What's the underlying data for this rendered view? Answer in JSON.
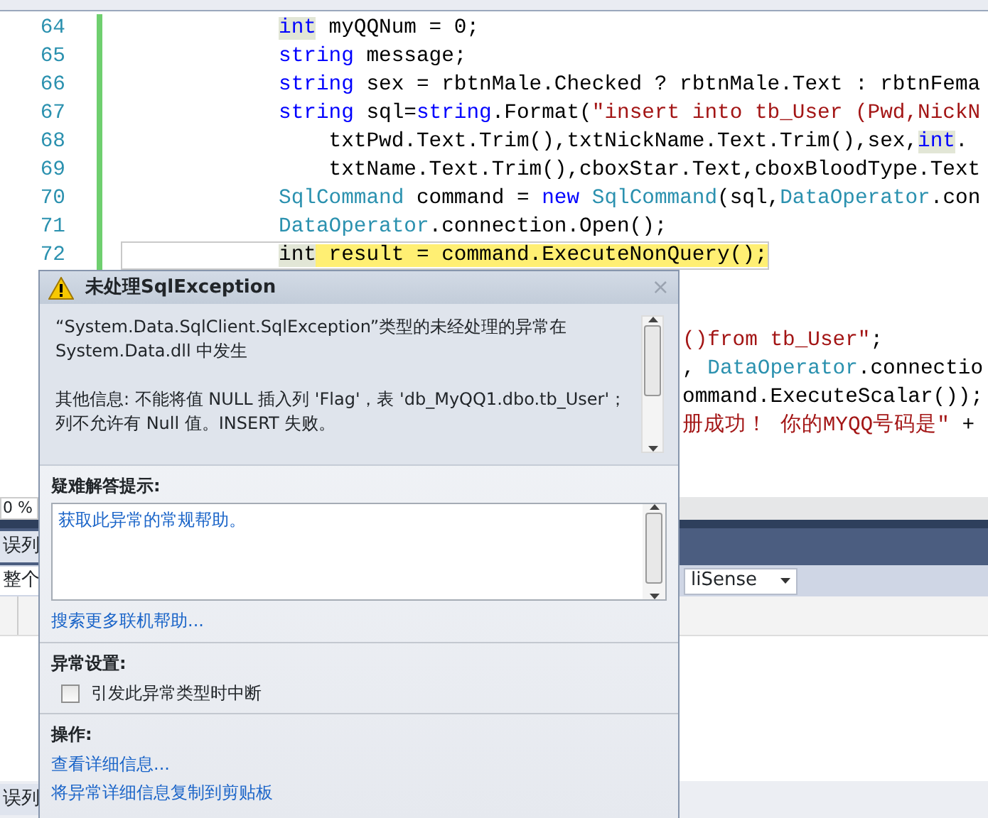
{
  "code": {
    "lines": [
      {
        "number": "64",
        "current": false,
        "tokens": [
          {
            "text": "int",
            "kind": "kw_ref"
          },
          {
            "text": " myQQNum = 0;",
            "kind": "plain"
          }
        ]
      },
      {
        "number": "65",
        "current": false,
        "tokens": [
          {
            "text": "string",
            "kind": "kw"
          },
          {
            "text": " message;",
            "kind": "plain"
          }
        ]
      },
      {
        "number": "66",
        "current": false,
        "tokens": [
          {
            "text": "string",
            "kind": "kw"
          },
          {
            "text": " sex = rbtnMale.Checked ? rbtnMale.Text : rbtnFema",
            "kind": "plain"
          }
        ]
      },
      {
        "number": "67",
        "current": false,
        "tokens": [
          {
            "text": "string",
            "kind": "kw"
          },
          {
            "text": " sql=",
            "kind": "plain"
          },
          {
            "text": "string",
            "kind": "kw"
          },
          {
            "text": ".Format(",
            "kind": "plain"
          },
          {
            "text": "\"insert into tb_User (Pwd,NickN",
            "kind": "str"
          }
        ]
      },
      {
        "number": "68",
        "current": false,
        "tokens": [
          {
            "text": "    txtPwd.Text.Trim(),txtNickName.Text.Trim(),sex,",
            "kind": "plain"
          },
          {
            "text": "int",
            "kind": "kw_ref"
          },
          {
            "text": ".",
            "kind": "plain"
          }
        ]
      },
      {
        "number": "69",
        "current": false,
        "tokens": [
          {
            "text": "    txtName.Text.Trim(),cboxStar.Text,cboxBloodType.Text",
            "kind": "plain"
          }
        ]
      },
      {
        "number": "70",
        "current": false,
        "tokens": [
          {
            "text": "SqlCommand",
            "kind": "type"
          },
          {
            "text": " command = ",
            "kind": "plain"
          },
          {
            "text": "new ",
            "kind": "kw"
          },
          {
            "text": "SqlCommand",
            "kind": "type"
          },
          {
            "text": "(sql,",
            "kind": "plain"
          },
          {
            "text": "DataOperator",
            "kind": "type"
          },
          {
            "text": ".con",
            "kind": "plain"
          }
        ]
      },
      {
        "number": "71",
        "current": false,
        "tokens": [
          {
            "text": "DataOperator",
            "kind": "type"
          },
          {
            "text": ".connection.Open();",
            "kind": "plain"
          }
        ]
      },
      {
        "number": "72",
        "current": true,
        "tokens": [
          {
            "text": "int",
            "kind": "ref"
          },
          {
            "text": " result = command.ExecuteNonQuery();",
            "kind": "stmt"
          }
        ]
      }
    ],
    "behind_dialog": [
      [
        {
          "text": "()from tb_User\"",
          "kind": "str"
        },
        {
          "text": ";",
          "kind": "plain"
        }
      ],
      [
        {
          "text": ", ",
          "kind": "plain"
        },
        {
          "text": "DataOperator",
          "kind": "type"
        },
        {
          "text": ".connectio",
          "kind": "plain"
        }
      ],
      [
        {
          "text": "ommand.ExecuteScalar());",
          "kind": "plain"
        }
      ],
      [
        {
          "text": "册成功！ 你的MYQQ号码是\"",
          "kind": "str"
        },
        {
          "text": " +",
          "kind": "plain"
        }
      ]
    ]
  },
  "zoom_level": "0 %",
  "tool_window": {
    "tab_title": "误列",
    "filter": "整个",
    "dropdown": "liSense",
    "bottom_tab": "误列"
  },
  "dialog": {
    "title": "未处理SqlException",
    "close": "×",
    "message": [
      "“System.Data.SqlClient.SqlException”类型的未经处理的异常在 System.Data.dll 中发生",
      "其他信息: 不能将值 NULL 插入列 'Flag'，表 'db_MyQQ1.dbo.tb_User'；列不允许有 Null 值。INSERT 失败。"
    ],
    "troubleshooting": {
      "heading": "疑难解答提示:",
      "tips": [
        "获取此异常的常规帮助。"
      ],
      "more_link": "搜索更多联机帮助..."
    },
    "exception_settings": {
      "heading": "异常设置:",
      "checkbox": {
        "label": "引发此异常类型时中断",
        "checked": false
      }
    },
    "actions": {
      "heading": "操作:",
      "links": [
        "查看详细信息...",
        "将异常详细信息复制到剪贴板"
      ]
    }
  }
}
